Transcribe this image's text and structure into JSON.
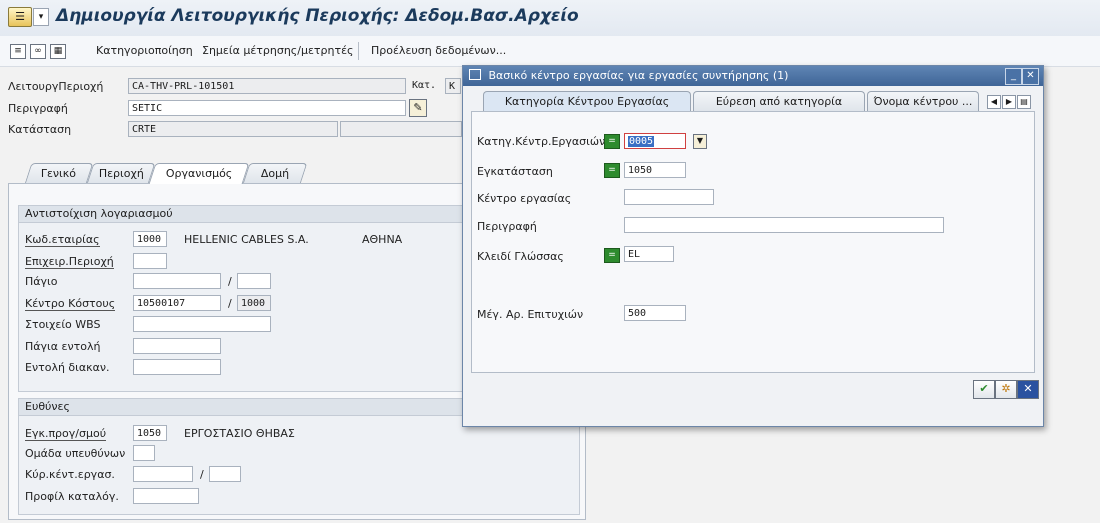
{
  "title": "Δημιουργία Λειτουργικής Περιοχής: Δεδομ.Βασ.Αρχείο",
  "toolbar": {
    "categorization": "Κατηγοριοποίηση",
    "measuring_points": "Σημεία μέτρησης/μετρητές",
    "data_origin": "Προέλευση δεδομένων..."
  },
  "header": {
    "func_loc_label": "ΛειτουργΠεριοχή",
    "func_loc_value": "CA-THV-PRL-101501",
    "cat_label": "Κατ.",
    "cat_value": "K",
    "description_label": "Περιγραφή",
    "description_value": "SETIC",
    "status_label": "Κατάσταση",
    "status_value": "CRTE"
  },
  "tabs": [
    "Γενικό",
    "Περιοχή",
    "Οργανισμός",
    "Δομή"
  ],
  "account_group": {
    "heading": "Αντιστοίχιση λογαριασμού",
    "company_code_label": "Κωδ.εταιρίας",
    "company_code_value": "1000",
    "company_name": "HELLENIC CABLES S.A.",
    "company_city": "ΑΘΗΝΑ",
    "business_area_label": "Επιχειρ.Περιοχή",
    "asset_label": "Πάγιο",
    "cost_center_label": "Κέντρο Κόστους",
    "cost_center_value": "10500107",
    "cost_center_area": "1000",
    "wbs_label": "Στοιχείο WBS",
    "asset_order_label": "Πάγια εντολή",
    "settlement_order_label": "Εντολή διακαν.",
    "slash": "/"
  },
  "resp_group": {
    "heading": "Ευθύνες",
    "plant_label": "Εγκ.προγ/σμού",
    "plant_value": "1050",
    "plant_name": "ΕΡΓΟΣΤΑΣΙΟ ΘΗΒΑΣ",
    "planner_group_label": "Ομάδα υπευθύνων",
    "main_wc_label": "Κύρ.κέντ.εργασ.",
    "catalog_profile_label": "Προφίλ καταλόγ.",
    "slash": "/"
  },
  "popup": {
    "title": "Βασικό κέντρο εργασίας για εργασίες συντήρησης (1)",
    "tabs": [
      "Κατηγορία Κέντρου Εργασίας",
      "Εύρεση από κατηγορία",
      "Όνομα κέντρου ..."
    ],
    "wc_category_label": "Κατηγ.Κέντρ.Εργασιών",
    "wc_category_value": "0005",
    "plant_label": "Εγκατάσταση",
    "plant_value": "1050",
    "work_center_label": "Κέντρο εργασίας",
    "description_label": "Περιγραφή",
    "language_label": "Κλειδί Γλώσσας",
    "language_value": "EL",
    "max_hits_label": "Μέγ. Αρ. Επιτυχιών",
    "max_hits_value": "500"
  }
}
